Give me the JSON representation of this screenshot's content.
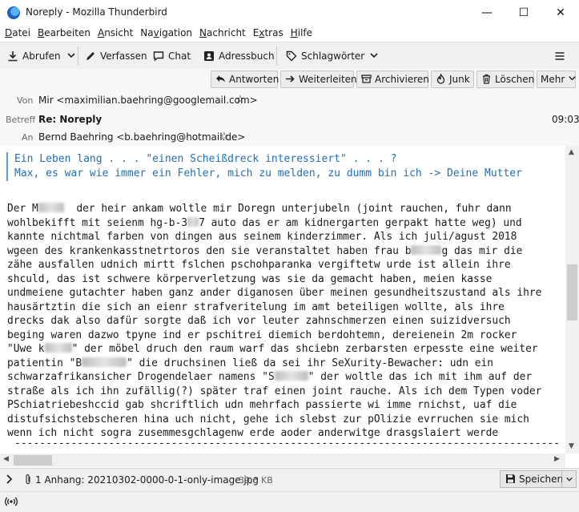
{
  "window": {
    "title": "Noreply - Mozilla Thunderbird",
    "minimize": "—",
    "maximize": "☐",
    "close": "✕"
  },
  "menubar": {
    "items": [
      {
        "label": "Datei",
        "accel": "D",
        "rest": "atei"
      },
      {
        "label": "Bearbeiten",
        "accel": "B",
        "rest": "earbeiten"
      },
      {
        "label": "Ansicht",
        "accel": "A",
        "rest": "nsicht"
      },
      {
        "label": "Navigation",
        "accel": "",
        "pre": "Na",
        "accel2": "v",
        "rest": "igation"
      },
      {
        "label": "Nachricht",
        "accel": "N",
        "rest": "achricht"
      },
      {
        "label": "Extras",
        "accel": "",
        "pre": "E",
        "accel2": "x",
        "rest": "tras"
      },
      {
        "label": "Hilfe",
        "accel": "H",
        "rest": "ilfe"
      }
    ]
  },
  "toolbar": {
    "get_messages": "Abrufen",
    "write": "Verfassen",
    "chat": "Chat",
    "address_book": "Adressbuch",
    "tags": "Schlagwörter"
  },
  "header": {
    "actions": {
      "reply": "Antworten",
      "forward": "Weiterleiten",
      "archive": "Archivieren",
      "junk": "Junk",
      "delete": "Löschen",
      "more": "Mehr"
    },
    "from_label": "Von",
    "from_value": "Mir <maximilian.baehring@googlemail.com>",
    "subject_label": "Betreff",
    "subject_value": "Re: Noreply",
    "time": "09:03",
    "to_label": "An",
    "to_value": "Bernd Baehring <b.baehring@hotmail.de>"
  },
  "body": {
    "quote_lines": [
      "Ein Leben lang . . . \"einen Scheißdreck interessiert\" . . . ?",
      "Max, es war wie immer ein Fehler, mich zu melden, zu dumm bin ich -> Deine Mutter"
    ],
    "dashes": "---------------------------------------------------------------------------------------"
  },
  "attachment": {
    "summary": "1 Anhang: 20210302-0000-0-1-only-image.jpg",
    "size": "39,6 KB",
    "save": "Speichern"
  }
}
